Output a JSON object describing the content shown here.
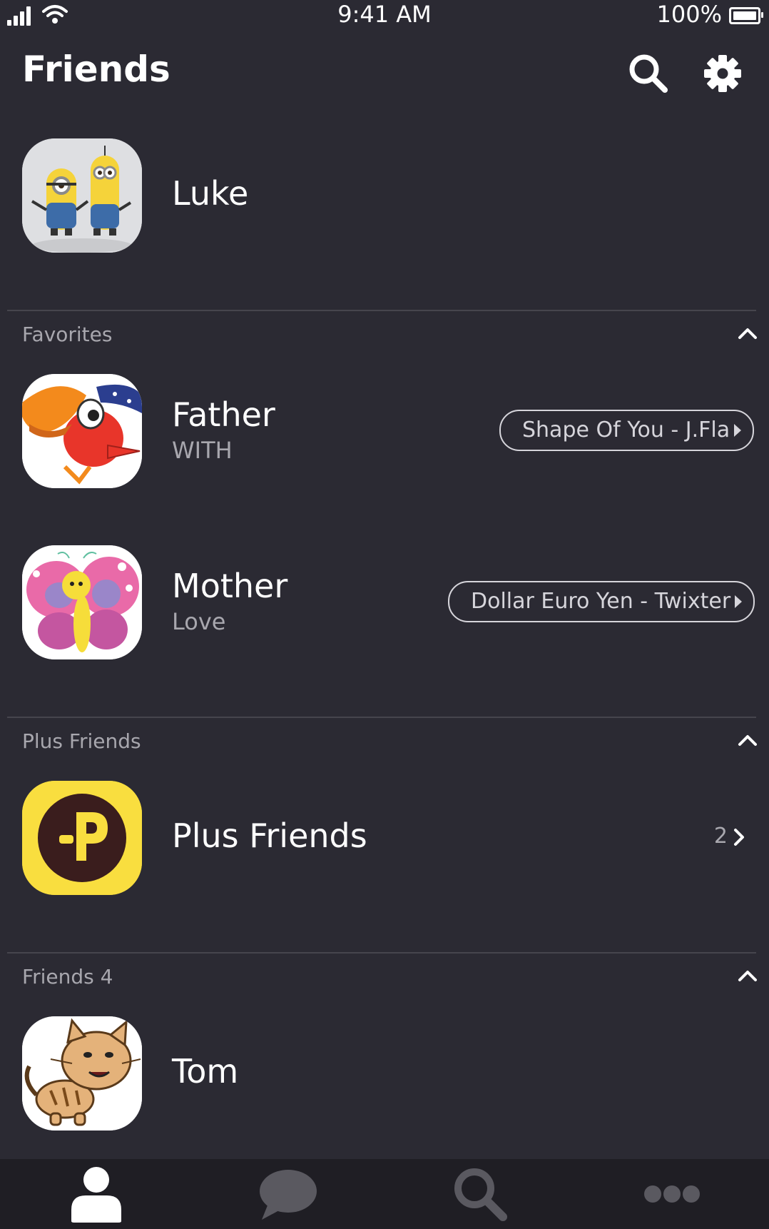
{
  "status_bar": {
    "time": "9:41 AM",
    "battery_percent": "100%"
  },
  "header": {
    "title": "Friends",
    "search_icon": "search-icon",
    "settings_icon": "gear-icon"
  },
  "profile": {
    "name": "Luke",
    "avatar": "minions-avatar"
  },
  "sections": {
    "favorites": {
      "label": "Favorites",
      "items": [
        {
          "name": "Father",
          "status": "WITH",
          "music": "Shape Of You - J.Fla",
          "avatar": "parrot-avatar"
        },
        {
          "name": "Mother",
          "status": "Love",
          "music": "Dollar Euro Yen - Twixter",
          "avatar": "butterfly-avatar"
        }
      ]
    },
    "plus_friends": {
      "label": "Plus Friends",
      "item": {
        "name": "Plus Friends",
        "count": "2",
        "avatar": "plus-friends-logo"
      }
    },
    "friends": {
      "label": "Friends 4",
      "items": [
        {
          "name": "Tom",
          "avatar": "cat-avatar"
        }
      ]
    }
  },
  "tabbar": {
    "tabs": [
      {
        "icon": "person-icon",
        "active": true
      },
      {
        "icon": "chat-bubble-icon",
        "active": false
      },
      {
        "icon": "search-icon",
        "active": false
      },
      {
        "icon": "more-icon",
        "active": false
      }
    ]
  },
  "colors": {
    "background": "#2b2a33",
    "tabbar": "#1f1e24",
    "muted_text": "#a8a7ae",
    "plus_yellow": "#f9de3f"
  }
}
